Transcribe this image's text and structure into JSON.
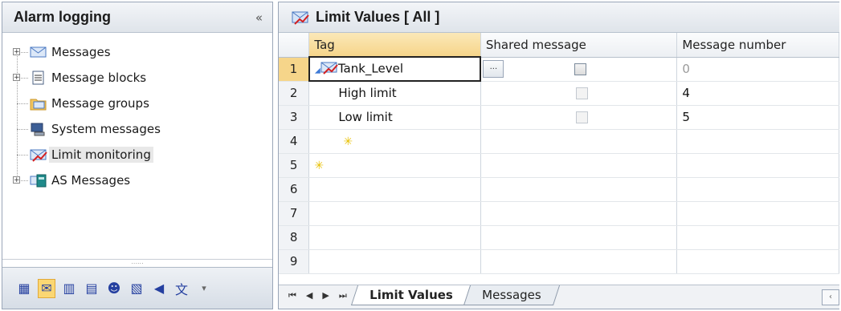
{
  "left_panel": {
    "title": "Alarm logging",
    "collapse_label": "«",
    "tree": [
      {
        "label": "Messages",
        "icon": "envelope-icon",
        "expandable": true
      },
      {
        "label": "Message blocks",
        "icon": "document-icon",
        "expandable": true
      },
      {
        "label": "Message groups",
        "icon": "folder-envelope-icon",
        "expandable": false
      },
      {
        "label": "System messages",
        "icon": "computer-icon",
        "expandable": false
      },
      {
        "label": "Limit monitoring",
        "icon": "limit-envelope-icon",
        "expandable": false,
        "selected": true
      },
      {
        "label": "AS Messages",
        "icon": "plc-icon",
        "expandable": true
      }
    ],
    "grip": "......",
    "toolbar": [
      {
        "icon": "grid-icon",
        "glyph": "▦",
        "active": false
      },
      {
        "icon": "limit-icon",
        "glyph": "✉",
        "active": true
      },
      {
        "icon": "columns-icon",
        "glyph": "▥",
        "active": false
      },
      {
        "icon": "list-icon",
        "glyph": "▤",
        "active": false
      },
      {
        "icon": "users-icon",
        "glyph": "☻",
        "active": false
      },
      {
        "icon": "blocks-icon",
        "glyph": "▧",
        "active": false
      },
      {
        "icon": "speaker-icon",
        "glyph": "◀",
        "active": false
      },
      {
        "icon": "language-icon",
        "glyph": "文",
        "active": false
      },
      {
        "icon": "more-icon",
        "glyph": "▾",
        "active": false
      }
    ]
  },
  "main": {
    "title": "Limit Values [ All ]",
    "columns": [
      "Tag",
      "Shared message",
      "Message number"
    ],
    "rows": [
      {
        "num": "1",
        "tag": "Tank_Level",
        "type": "tag",
        "shared": "ellipsis-checkbox",
        "msg": "0"
      },
      {
        "num": "2",
        "tag": "High limit",
        "type": "child",
        "shared": "checkbox-disabled",
        "msg": "4"
      },
      {
        "num": "3",
        "tag": "Low limit",
        "type": "child",
        "shared": "checkbox-disabled",
        "msg": "5"
      },
      {
        "num": "4",
        "tag": "",
        "type": "new-child",
        "shared": "",
        "msg": ""
      },
      {
        "num": "5",
        "tag": "",
        "type": "new",
        "shared": "",
        "msg": ""
      },
      {
        "num": "6",
        "tag": "",
        "type": "empty",
        "shared": "",
        "msg": ""
      },
      {
        "num": "7",
        "tag": "",
        "type": "empty",
        "shared": "",
        "msg": ""
      },
      {
        "num": "8",
        "tag": "",
        "type": "empty",
        "shared": "",
        "msg": ""
      },
      {
        "num": "9",
        "tag": "",
        "type": "empty",
        "shared": "",
        "msg": ""
      }
    ],
    "new_marker": "✳",
    "ellipsis": "...",
    "tabs": [
      {
        "label": "Limit Values",
        "active": true
      },
      {
        "label": "Messages",
        "active": false
      }
    ],
    "nav": [
      "⏮",
      "◀",
      "▶",
      "⏭"
    ]
  },
  "colors": {
    "header_accent": "#f6d58a",
    "border": "#9aa6b8",
    "selection": "#fbd773"
  }
}
